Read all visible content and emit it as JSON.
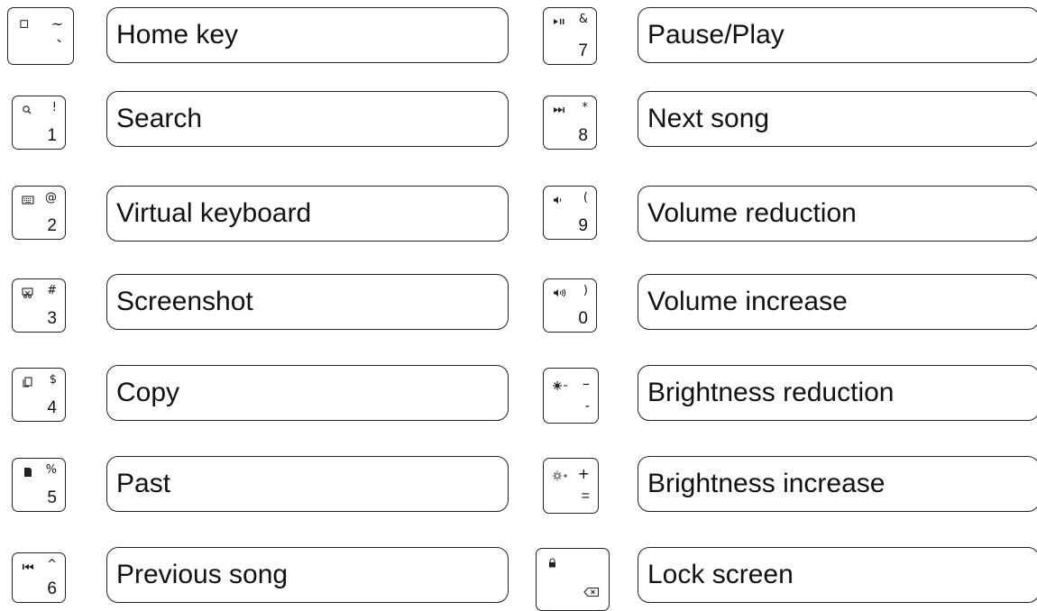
{
  "left_column": [
    {
      "icon": "home-square-icon",
      "shift": "~",
      "main": "`",
      "label": "Home key"
    },
    {
      "icon": "search-icon",
      "shift": "!",
      "main": "1",
      "label": "Search"
    },
    {
      "icon": "keyboard-icon",
      "shift": "@",
      "main": "2",
      "label": "Virtual keyboard"
    },
    {
      "icon": "screenshot-icon",
      "shift": "#",
      "main": "3",
      "label": "Screenshot"
    },
    {
      "icon": "copy-icon",
      "shift": "$",
      "main": "4",
      "label": "Copy"
    },
    {
      "icon": "paste-icon",
      "shift": "%",
      "main": "5",
      "label": "Past"
    },
    {
      "icon": "previous-track-icon",
      "shift": "^",
      "main": "6",
      "label": "Previous song"
    }
  ],
  "right_column": [
    {
      "icon": "play-pause-icon",
      "shift": "&",
      "main": "7",
      "label": "Pause/Play"
    },
    {
      "icon": "next-track-icon",
      "shift": "*",
      "main": "8",
      "label": "Next song"
    },
    {
      "icon": "volume-down-icon",
      "shift": "(",
      "main": "9",
      "label": "Volume reduction"
    },
    {
      "icon": "volume-up-icon",
      "shift": ")",
      "main": "0",
      "label": "Volume increase"
    },
    {
      "icon": "brightness-down-icon",
      "shift": "–",
      "main": "-",
      "label": "Brightness reduction"
    },
    {
      "icon": "brightness-up-icon",
      "shift": "+",
      "main": "=",
      "label": "Brightness increase"
    },
    {
      "icon": "lock-icon",
      "shift": "",
      "main": "backspace-icon",
      "label": "Lock screen"
    }
  ]
}
